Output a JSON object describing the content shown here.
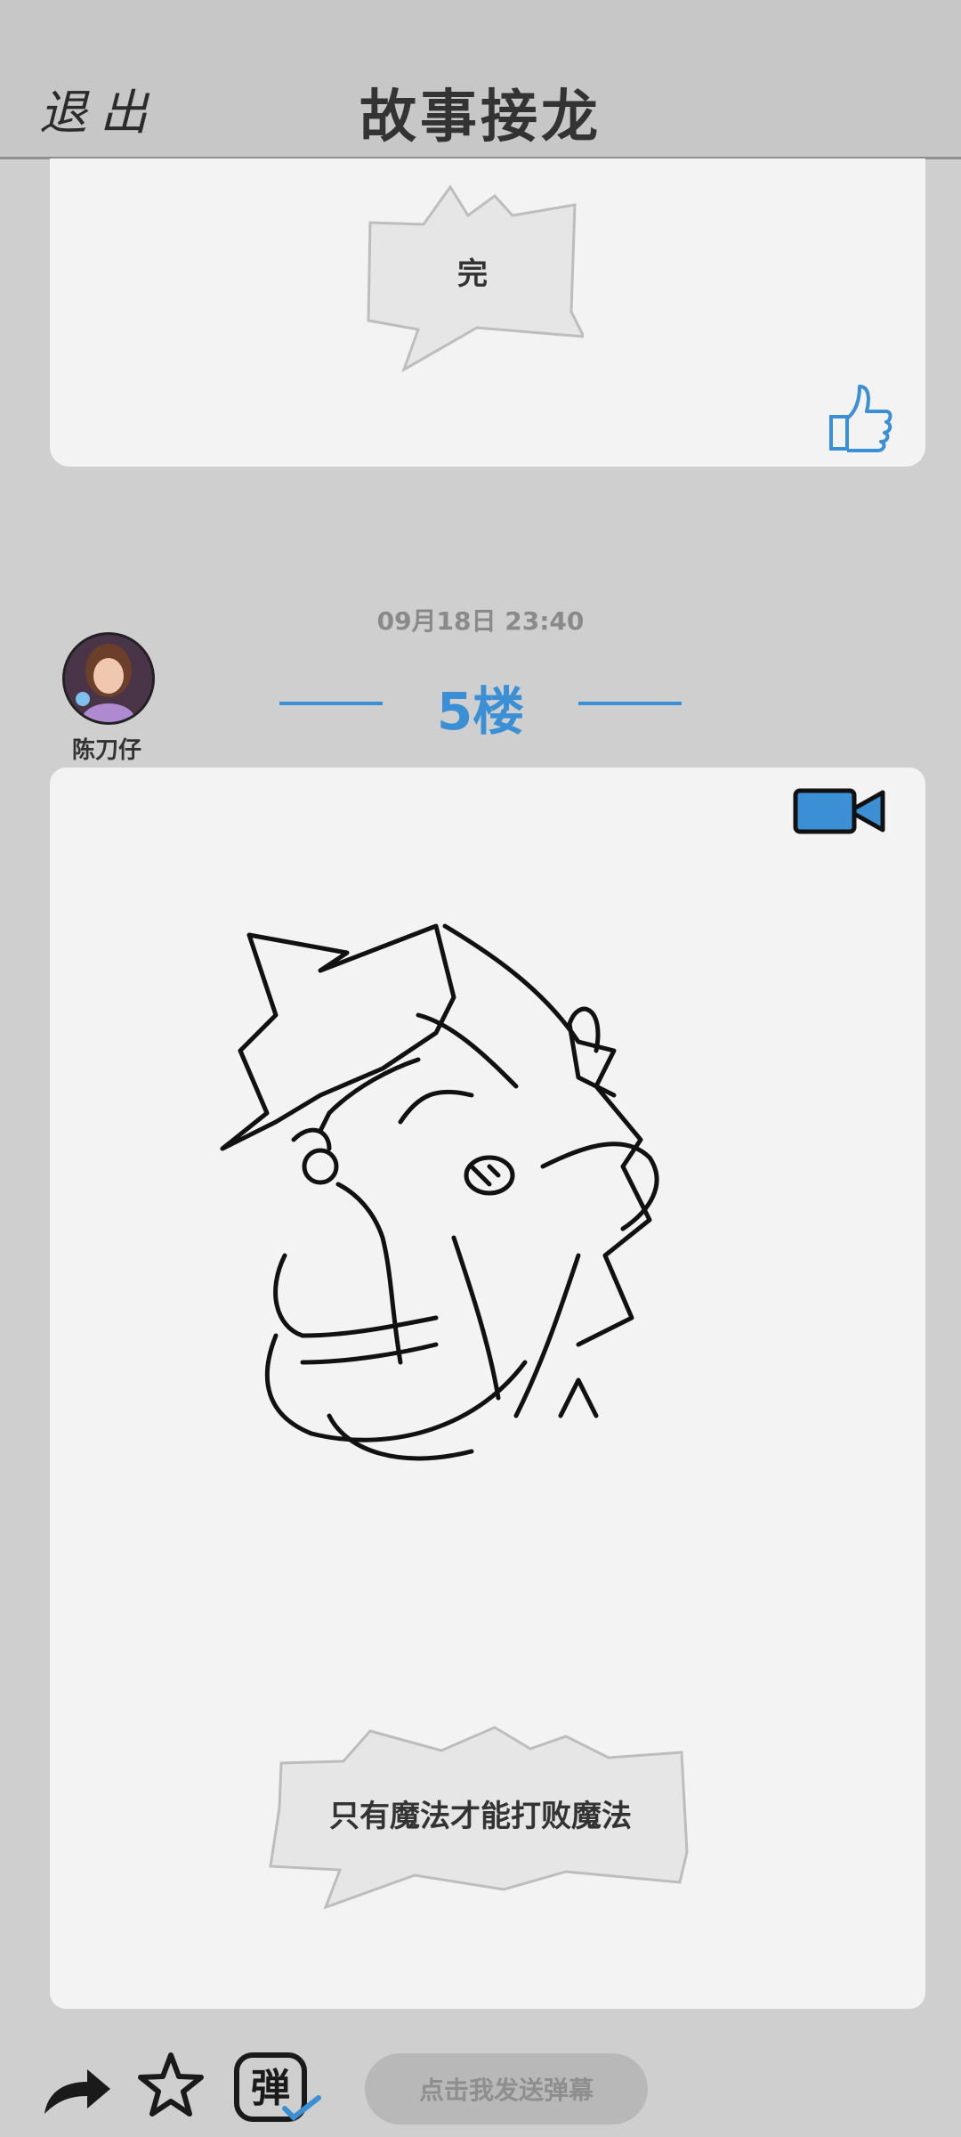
{
  "header": {
    "exit_label": "退出",
    "title": "故事接龙"
  },
  "previous_post": {
    "bubble_text": "完"
  },
  "post": {
    "timestamp": "09月18日  23:40",
    "username": "陈刀仔",
    "floor_label": "5楼",
    "bubble_text": "只有魔法才能打败魔法"
  },
  "bottom_bar": {
    "danmu_placeholder": "点击我发送弹幕",
    "danmu_icon_char": "弾"
  },
  "colors": {
    "accent": "#3b8fd4",
    "background": "#cfcfcf",
    "card": "#f3f3f3"
  },
  "icons": [
    "thumbs-up-icon",
    "video-camera-icon",
    "share-arrow-icon",
    "star-icon",
    "danmu-icon"
  ]
}
